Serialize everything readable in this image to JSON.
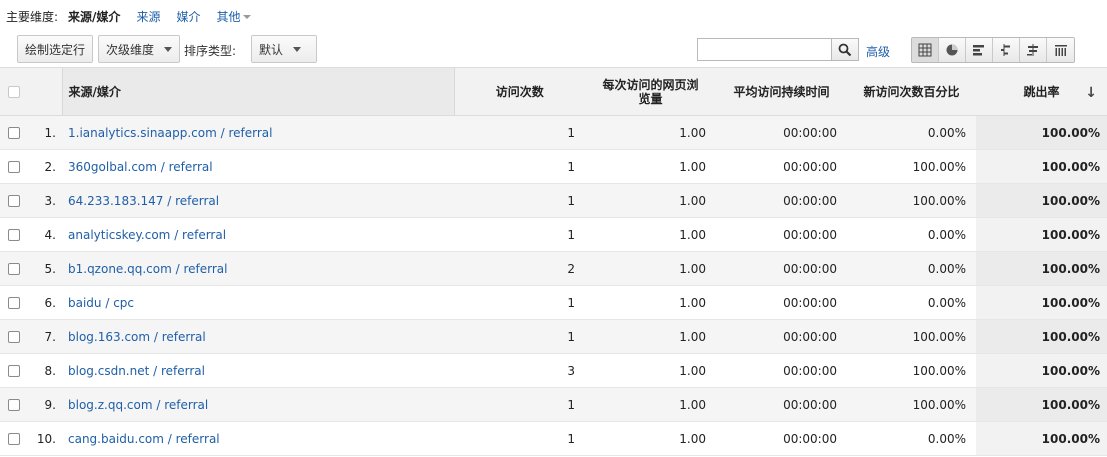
{
  "dimensions": {
    "label": "主要维度:",
    "current": "来源/媒介",
    "links": [
      "来源",
      "媒介"
    ],
    "other": "其他"
  },
  "toolbar": {
    "plot_rows": "绘制选定行",
    "secondary_dimension": "次级维度",
    "sort_type_label": "排序类型:",
    "sort_value": "默认",
    "search_value": "",
    "advanced": "高级"
  },
  "views": [
    "table-icon",
    "pie-chart-icon",
    "performance-icon",
    "comparison-icon",
    "term-cloud-icon",
    "pivot-icon"
  ],
  "table": {
    "columns": [
      "来源/媒介",
      "访问次数",
      "每次访问的网页浏览量",
      "平均访问持续时间",
      "新访问次数百分比",
      "跳出率"
    ],
    "sorted_column_arrow": "↓",
    "rows": [
      {
        "idx": "1.",
        "source": "1.ianalytics.sinaapp.com / referral",
        "visits": "1",
        "pages": "1.00",
        "duration": "00:00:00",
        "new": "0.00%",
        "bounce": "100.00%"
      },
      {
        "idx": "2.",
        "source": "360golbal.com / referral",
        "visits": "1",
        "pages": "1.00",
        "duration": "00:00:00",
        "new": "100.00%",
        "bounce": "100.00%"
      },
      {
        "idx": "3.",
        "source": "64.233.183.147 / referral",
        "visits": "1",
        "pages": "1.00",
        "duration": "00:00:00",
        "new": "100.00%",
        "bounce": "100.00%"
      },
      {
        "idx": "4.",
        "source": "analyticskey.com / referral",
        "visits": "1",
        "pages": "1.00",
        "duration": "00:00:00",
        "new": "0.00%",
        "bounce": "100.00%"
      },
      {
        "idx": "5.",
        "source": "b1.qzone.qq.com / referral",
        "visits": "2",
        "pages": "1.00",
        "duration": "00:00:00",
        "new": "0.00%",
        "bounce": "100.00%"
      },
      {
        "idx": "6.",
        "source": "baidu / cpc",
        "visits": "1",
        "pages": "1.00",
        "duration": "00:00:00",
        "new": "0.00%",
        "bounce": "100.00%"
      },
      {
        "idx": "7.",
        "source": "blog.163.com / referral",
        "visits": "1",
        "pages": "1.00",
        "duration": "00:00:00",
        "new": "100.00%",
        "bounce": "100.00%"
      },
      {
        "idx": "8.",
        "source": "blog.csdn.net / referral",
        "visits": "3",
        "pages": "1.00",
        "duration": "00:00:00",
        "new": "100.00%",
        "bounce": "100.00%"
      },
      {
        "idx": "9.",
        "source": "blog.z.qq.com / referral",
        "visits": "1",
        "pages": "1.00",
        "duration": "00:00:00",
        "new": "100.00%",
        "bounce": "100.00%"
      },
      {
        "idx": "10.",
        "source": "cang.baidu.com / referral",
        "visits": "1",
        "pages": "1.00",
        "duration": "00:00:00",
        "new": "0.00%",
        "bounce": "100.00%"
      }
    ]
  }
}
